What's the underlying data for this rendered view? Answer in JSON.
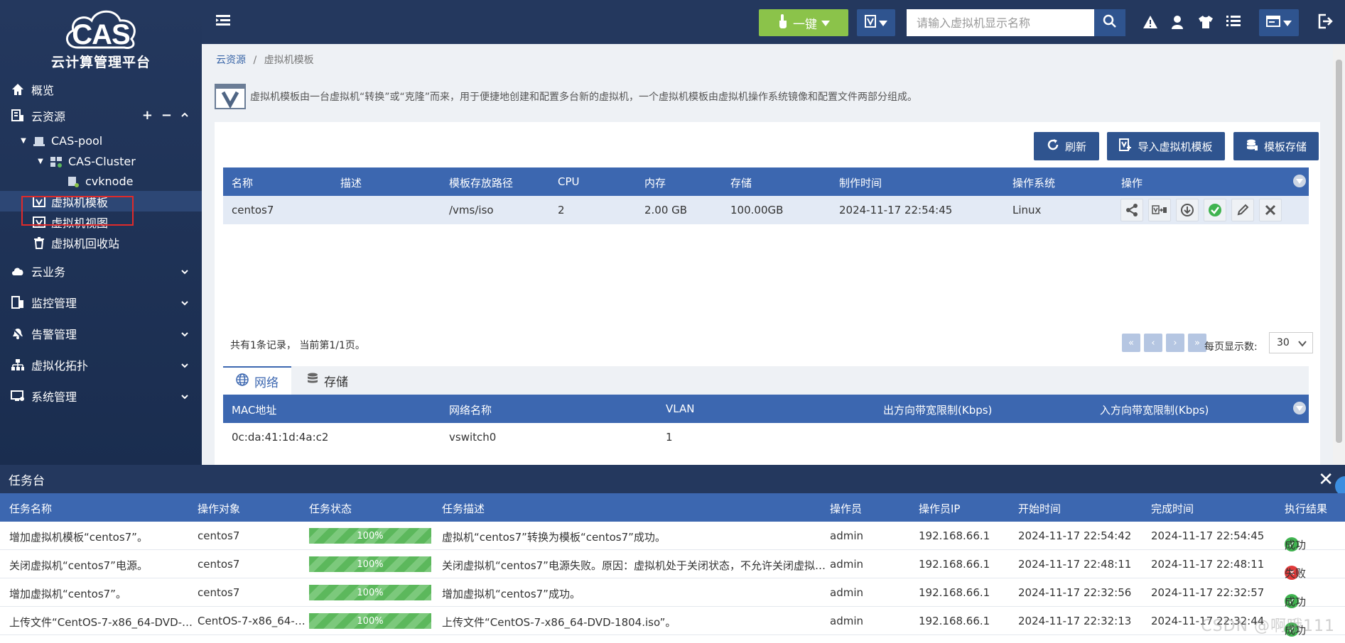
{
  "logo": {
    "brand": "CAS",
    "subtitle": "云计算管理平台"
  },
  "sidebar": {
    "overview": "概览",
    "cloud_resources": "云资源",
    "resource_controls": {
      "add": "+",
      "remove": "−"
    },
    "tree": {
      "pool": "CAS-pool",
      "cluster": "CAS-Cluster",
      "host": "cvknode",
      "vm_template": "虚拟机模板",
      "vm_view": "虚拟机视图",
      "vm_recycle": "虚拟机回收站"
    },
    "cloud_service": "云业务",
    "monitoring": "监控管理",
    "alarms": "告警管理",
    "topology": "虚拟化拓扑",
    "system": "系统管理"
  },
  "topbar": {
    "onekey_label": "一键",
    "search_placeholder": "请输入虚拟机显示名称"
  },
  "breadcrumb": {
    "root": "云资源",
    "sep": "/",
    "current": "虚拟机模板"
  },
  "intro": "虚拟机模板由一台虚拟机“转换”或“克隆”而来，用于便捷地创建和配置多台新的虚拟机，一个虚拟机模板由虚拟机操作系统镜像和配置文件两部分组成。",
  "toolbar": {
    "refresh": "刷新",
    "import": "导入虚拟机模板",
    "storage": "模板存储"
  },
  "template_table": {
    "columns": [
      "名称",
      "描述",
      "模板存放路径",
      "CPU",
      "内存",
      "存储",
      "制作时间",
      "操作系统",
      "操作"
    ],
    "rows": [
      {
        "name": "centos7",
        "desc": "",
        "path": "/vms/iso",
        "cpu": "2",
        "mem": "2.00 GB",
        "storage": "100.00GB",
        "created": "2024-11-17 22:54:45",
        "os": "Linux"
      }
    ]
  },
  "pager": {
    "info": "共有1条记录， 当前第1/1页。",
    "per_page_label": "每页显示数:",
    "per_page": "30"
  },
  "tabs": {
    "network": "网络",
    "storage": "存储"
  },
  "network_table": {
    "columns": [
      "MAC地址",
      "网络名称",
      "VLAN",
      "出方向带宽限制(Kbps)",
      "入方向带宽限制(Kbps)"
    ],
    "rows": [
      {
        "mac": "0c:da:41:1d:4a:c2",
        "network": "vswitch0",
        "vlan": "1"
      }
    ]
  },
  "tasks": {
    "title": "任务台",
    "columns": [
      "任务名称",
      "操作对象",
      "任务状态",
      "任务描述",
      "操作员",
      "操作员IP",
      "开始时间",
      "完成时间",
      "执行结果"
    ],
    "rows": [
      {
        "name": "增加虚拟机模板“centos7”。",
        "target": "centos7",
        "progress": "100%",
        "desc": "虚拟机“centos7”转换为模板“centos7”成功。",
        "operator": "admin",
        "ip": "192.168.66.1",
        "start": "2024-11-17 22:54:42",
        "end": "2024-11-17 22:54:45",
        "result": "成功",
        "status": "ok"
      },
      {
        "name": "关闭虚拟机“centos7”电源。",
        "target": "centos7",
        "progress": "100%",
        "desc": "关闭虚拟机“centos7”电源失败。原因：虚拟机处于关闭状态，不允许关闭虚拟…",
        "operator": "admin",
        "ip": "192.168.66.1",
        "start": "2024-11-17 22:48:11",
        "end": "2024-11-17 22:48:11",
        "result": "失败",
        "status": "fail"
      },
      {
        "name": "增加虚拟机“centos7”。",
        "target": "centos7",
        "progress": "100%",
        "desc": "增加虚拟机“centos7”成功。",
        "operator": "admin",
        "ip": "192.168.66.1",
        "start": "2024-11-17 22:32:56",
        "end": "2024-11-17 22:32:57",
        "result": "成功",
        "status": "ok"
      },
      {
        "name": "上传文件“CentOS-7-x86_64-DVD-…",
        "target": "CentOS-7-x86_64-…",
        "progress": "100%",
        "desc": "上传文件“CentOS-7-x86_64-DVD-1804.iso”。",
        "operator": "admin",
        "ip": "192.168.66.1",
        "start": "2024-11-17 22:32:13",
        "end": "2024-11-17 22:32:44",
        "result": "成功",
        "status": "ok"
      }
    ]
  },
  "watermark": "CSDN @啊哦111"
}
